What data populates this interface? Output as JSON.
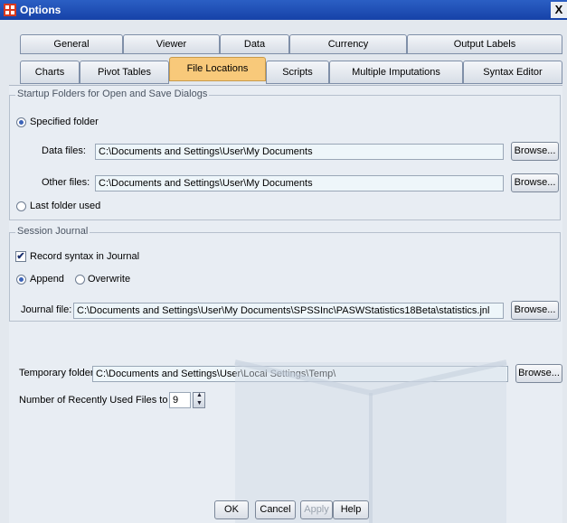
{
  "window": {
    "title": "Options",
    "close_glyph": "X"
  },
  "tabs_row1": [
    "General",
    "Viewer",
    "Data",
    "Currency",
    "Output Labels"
  ],
  "tabs_row2": [
    "Charts",
    "Pivot Tables",
    "File Locations",
    "Scripts",
    "Multiple Imputations",
    "Syntax Editor"
  ],
  "active_tab": "File Locations",
  "startup": {
    "legend": "Startup Folders for Open and Save Dialogs",
    "specified_label": "Specified folder",
    "data_label": "Data files:",
    "data_value": "C:\\Documents and Settings\\User\\My Documents",
    "other_label": "Other files:",
    "other_value": "C:\\Documents and Settings\\User\\My Documents",
    "last_label": "Last folder used",
    "selected": "specified"
  },
  "journal": {
    "legend": "Session Journal",
    "record_label": "Record syntax in Journal",
    "record_checked": true,
    "append_label": "Append",
    "overwrite_label": "Overwrite",
    "mode": "append",
    "file_label": "Journal file:",
    "file_value": "C:\\Documents and Settings\\User\\My Documents\\SPSSInc\\PASWStatistics18Beta\\statistics.jnl"
  },
  "temp": {
    "label": "Temporary folder:",
    "value": "C:\\Documents and Settings\\User\\Local Settings\\Temp\\"
  },
  "recent": {
    "label": "Number of Recently Used Files to List:",
    "value": "9"
  },
  "browse_label": "Browse...",
  "buttons": {
    "ok": "OK",
    "cancel": "Cancel",
    "apply": "Apply",
    "help": "Help"
  }
}
